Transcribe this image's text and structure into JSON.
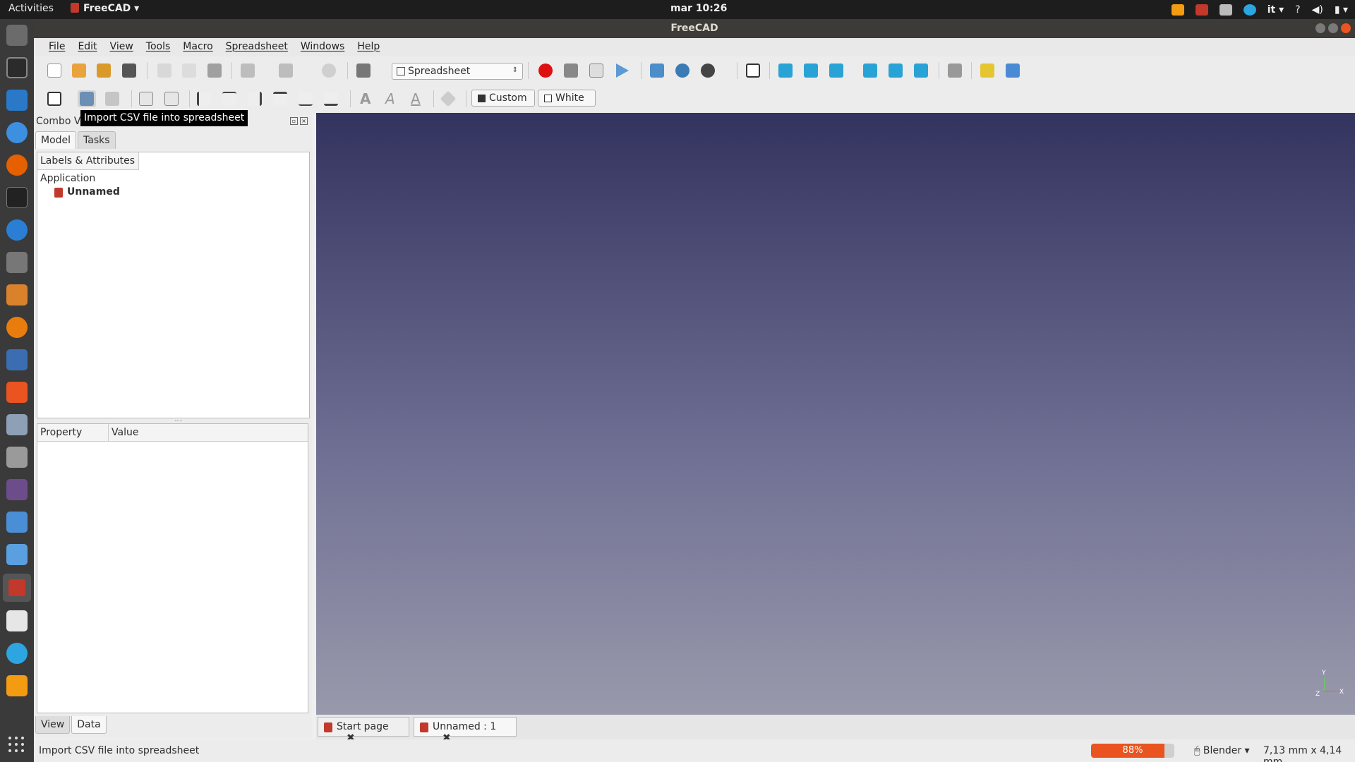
{
  "topbar": {
    "activities": "Activities",
    "app_name": "FreeCAD",
    "clock": "mar 10:26",
    "lang": "it"
  },
  "window": {
    "title": "FreeCAD"
  },
  "menu": [
    "File",
    "Edit",
    "View",
    "Tools",
    "Macro",
    "Spreadsheet",
    "Windows",
    "Help"
  ],
  "toolbar": {
    "workbench": "Spreadsheet",
    "color_custom": "Custom",
    "color_white": "White"
  },
  "tooltip": "Import CSV file into spreadsheet",
  "combo": {
    "title": "Combo Vi",
    "tab_model": "Model",
    "tab_tasks": "Tasks",
    "tree_header": "Labels & Attributes",
    "tree_app": "Application",
    "tree_doc": "Unnamed",
    "prop_col": "Property",
    "value_col": "Value",
    "tab_view": "View",
    "tab_data": "Data"
  },
  "view3d": {
    "axis_x": "X",
    "axis_y": "Y",
    "axis_z": "Z"
  },
  "doctabs": {
    "start": "Start page",
    "unnamed": "Unnamed : 1"
  },
  "status": {
    "message": "Import CSV file into spreadsheet",
    "progress_text": "88%",
    "progress_value": 88,
    "nav_style": "Blender",
    "dims": "7,13 mm x 4,14 mm"
  },
  "colors": {
    "accent": "#e95420",
    "freecad_red": "#c0392b"
  }
}
